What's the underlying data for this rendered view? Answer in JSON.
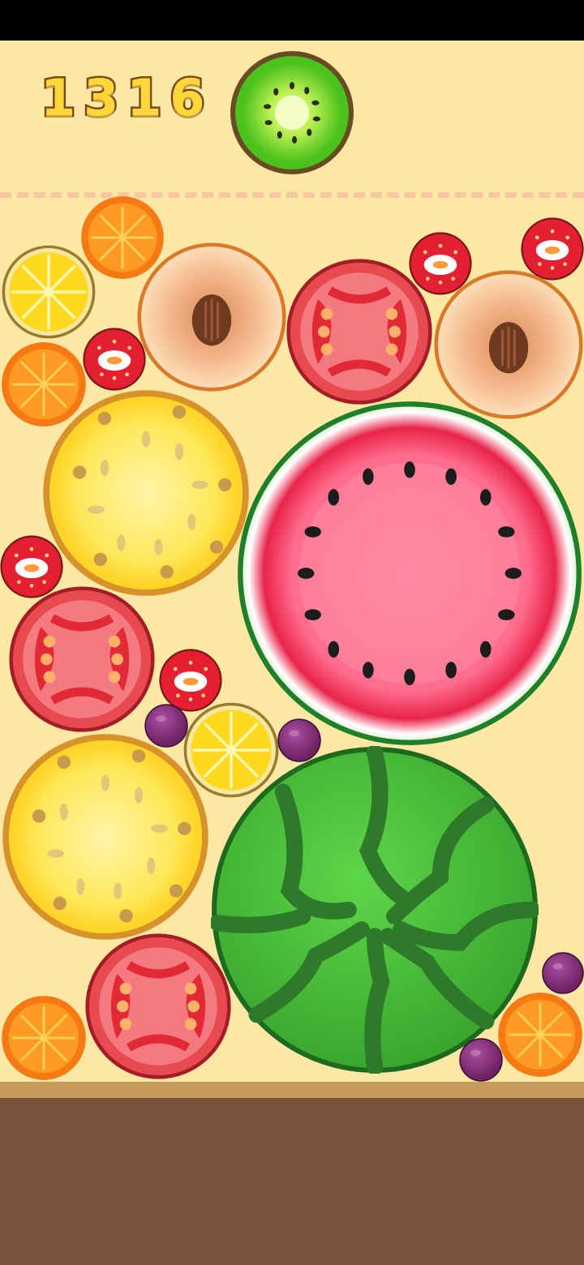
{
  "hud": {
    "score": "1316",
    "next_fruit": "kiwi"
  },
  "board": {
    "fruits": [
      "orange",
      "lemon",
      "peach",
      "tomato",
      "strawberry",
      "strawberry",
      "peach",
      "orange",
      "strawberry",
      "pineapple",
      "watermelon-slice",
      "strawberry",
      "tomato",
      "strawberry",
      "grape",
      "lemon",
      "grape",
      "pineapple",
      "whole-watermelon",
      "grape",
      "tomato",
      "orange",
      "orange",
      "grape"
    ]
  },
  "colors": {
    "background": "#ffe8a6",
    "score_fill": "#ffd73a",
    "score_outline": "#7a4a19",
    "ground": "#7b533a",
    "ground_edge": "#c69a5b"
  }
}
